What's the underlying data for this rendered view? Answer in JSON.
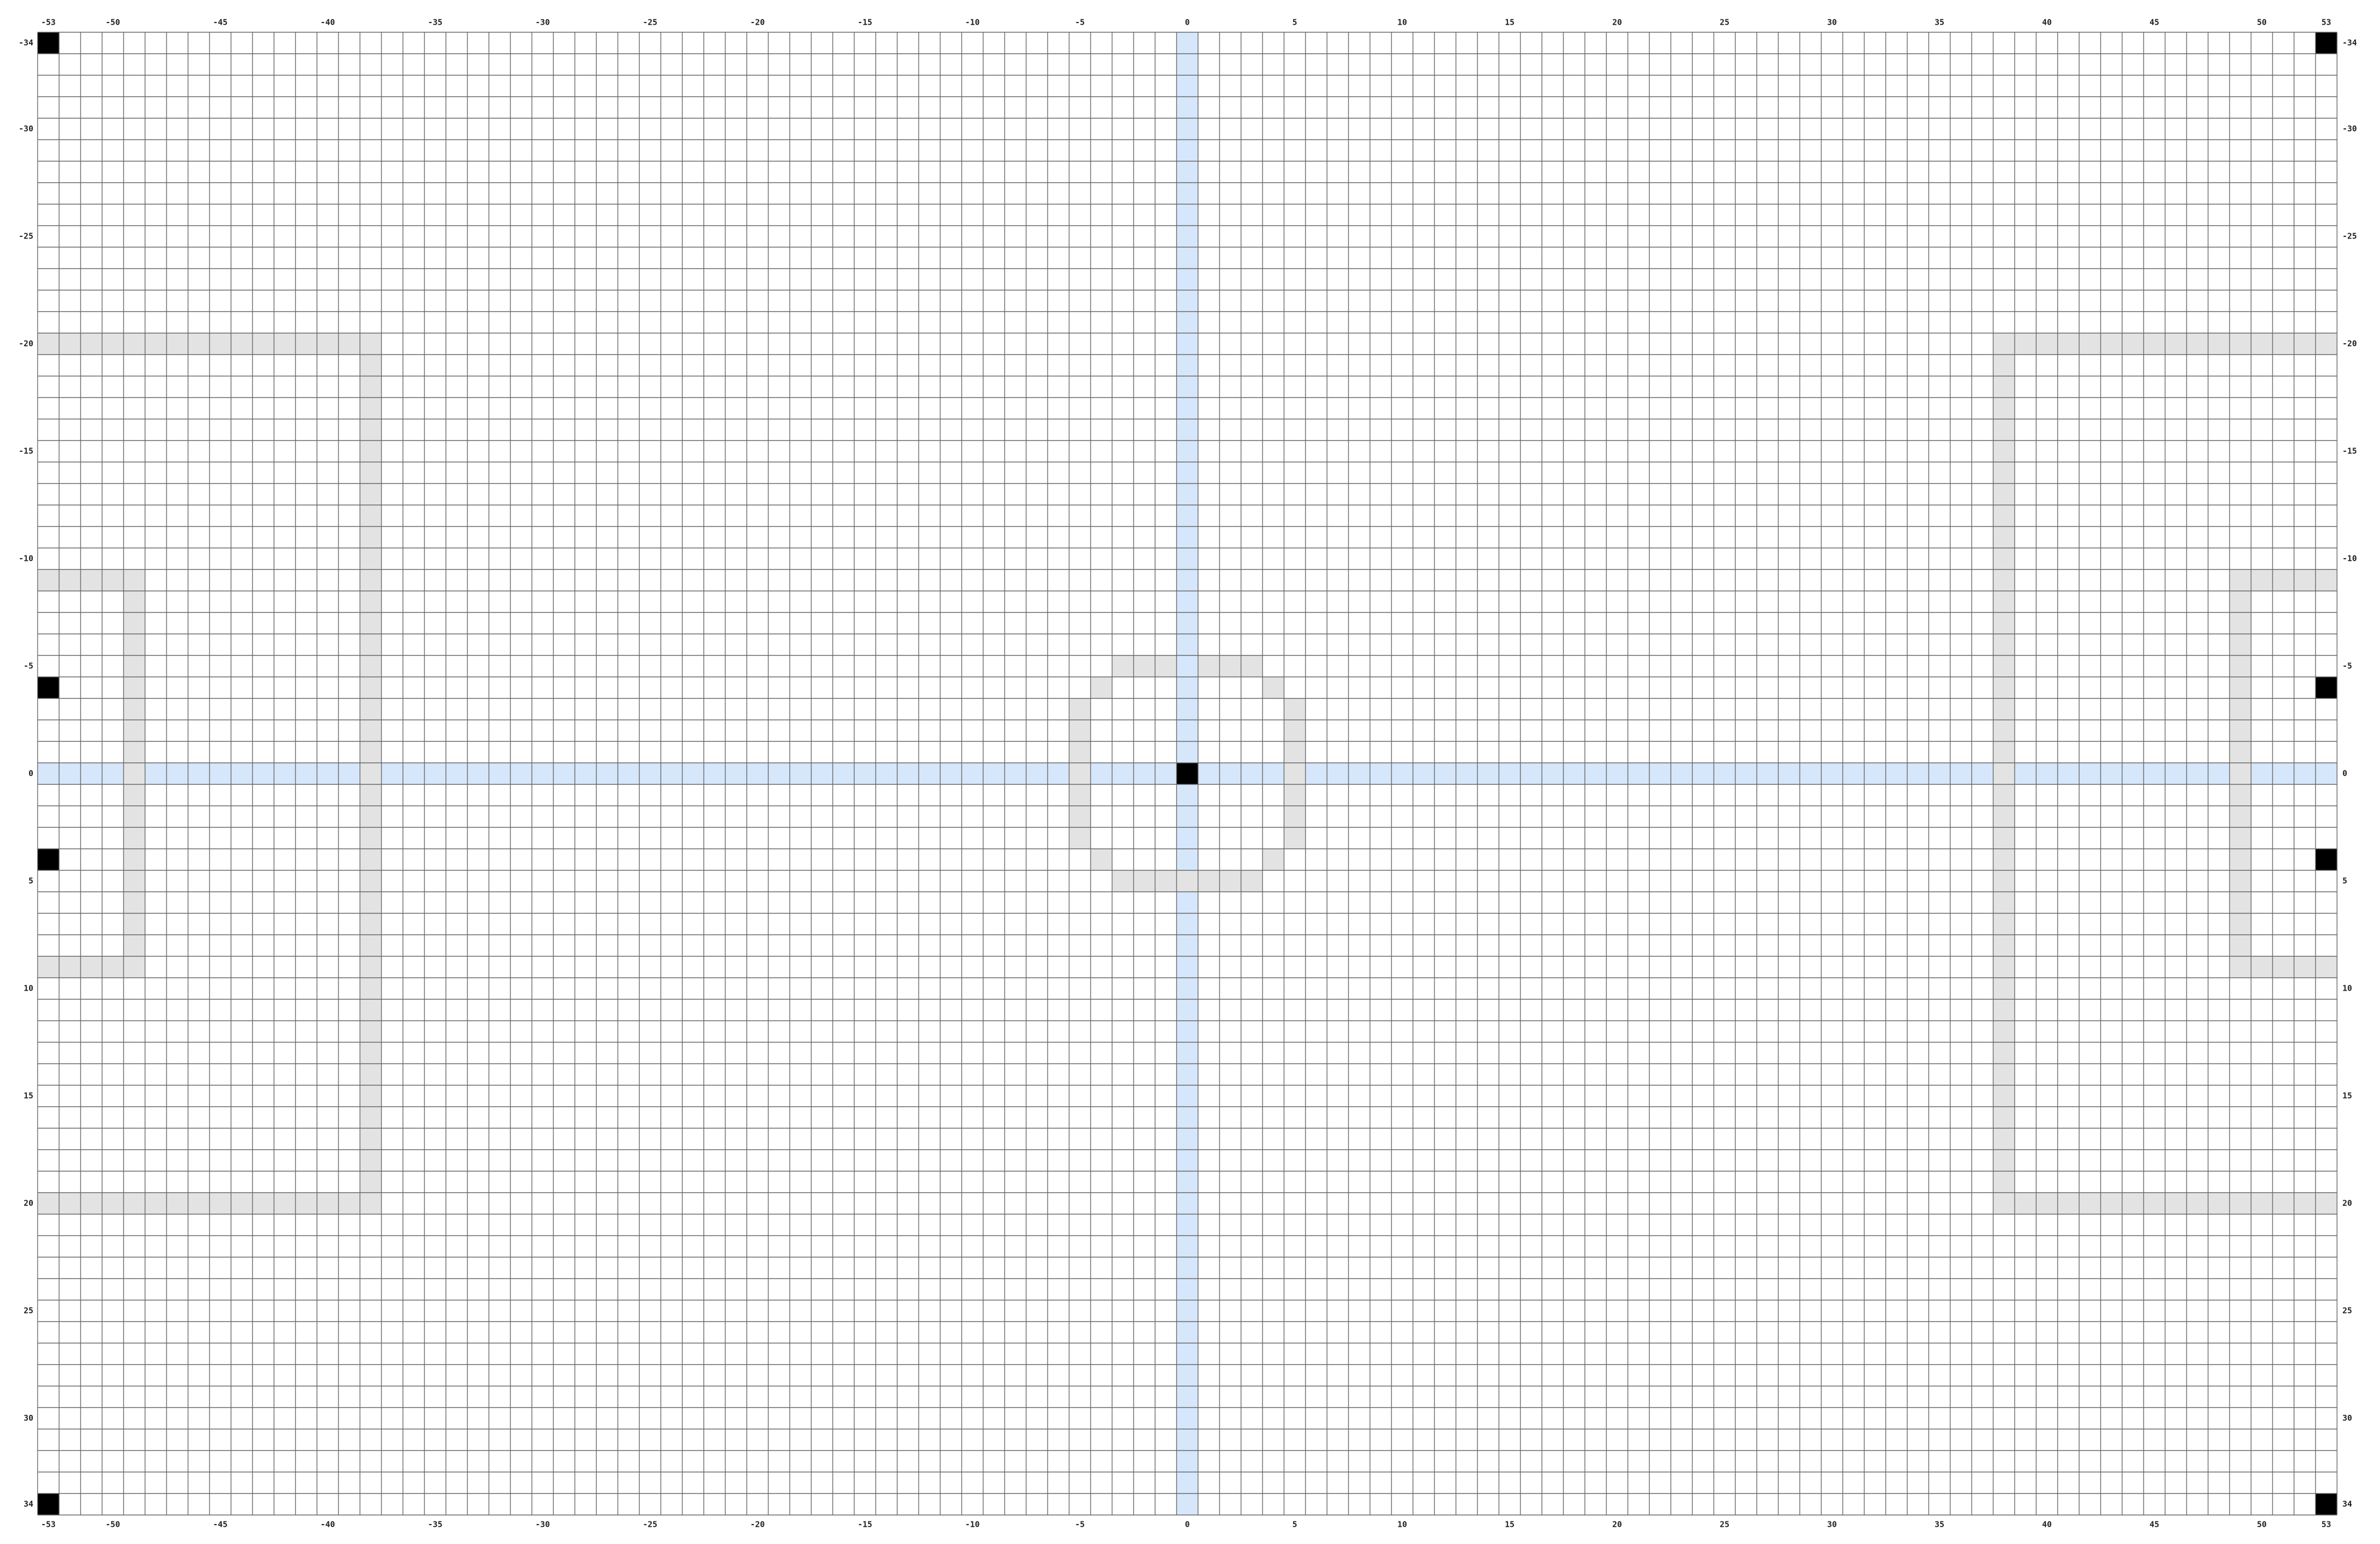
{
  "grid": {
    "x_min": -53,
    "x_max": 53,
    "y_min": -34,
    "y_max": 34,
    "axis_labels_x": [
      -53,
      -50,
      -45,
      -40,
      -35,
      -30,
      -25,
      -20,
      -15,
      -10,
      -5,
      0,
      5,
      10,
      15,
      20,
      25,
      30,
      35,
      40,
      45,
      50,
      53
    ],
    "axis_labels_y": [
      -34,
      -30,
      -25,
      -20,
      -15,
      -10,
      -5,
      0,
      5,
      10,
      15,
      20,
      25,
      30,
      34
    ],
    "colors": {
      "background": "#ffffff",
      "grid_line": "#666666",
      "axis_highlight": "#d6e6fb",
      "field_marking": "#e3e3e3",
      "marker": "#000000",
      "label": "#222222"
    }
  },
  "markers": [
    [
      -53,
      -34
    ],
    [
      53,
      -34
    ],
    [
      -53,
      34
    ],
    [
      53,
      34
    ],
    [
      -53,
      -4
    ],
    [
      -53,
      4
    ],
    [
      53,
      -4
    ],
    [
      53,
      4
    ],
    [
      0,
      0
    ]
  ],
  "field_markings": {
    "left_penalty_area": {
      "x_range": [
        -53,
        -38
      ],
      "y_range": [
        -20,
        20
      ]
    },
    "right_penalty_area": {
      "x_range": [
        38,
        53
      ],
      "y_range": [
        -20,
        20
      ]
    },
    "left_goal_area": {
      "x_range": [
        -53,
        -49
      ],
      "y_range": [
        -9,
        9
      ]
    },
    "right_goal_area": {
      "x_range": [
        49,
        53
      ],
      "y_range": [
        -9,
        9
      ]
    },
    "center_circle": {
      "cells": [
        [
          -3,
          -5
        ],
        [
          -2,
          -5
        ],
        [
          -1,
          -5
        ],
        [
          1,
          -5
        ],
        [
          2,
          -5
        ],
        [
          3,
          -5
        ],
        [
          -4,
          -4
        ],
        [
          4,
          -4
        ],
        [
          -5,
          -3
        ],
        [
          5,
          -3
        ],
        [
          -5,
          -2
        ],
        [
          5,
          -2
        ],
        [
          -5,
          -1
        ],
        [
          5,
          -1
        ],
        [
          -5,
          0
        ],
        [
          5,
          0
        ],
        [
          -5,
          1
        ],
        [
          5,
          1
        ],
        [
          -5,
          2
        ],
        [
          5,
          2
        ],
        [
          -5,
          3
        ],
        [
          5,
          3
        ],
        [
          -4,
          4
        ],
        [
          4,
          4
        ],
        [
          -3,
          5
        ],
        [
          -2,
          5
        ],
        [
          -1,
          5
        ],
        [
          0,
          5
        ],
        [
          1,
          5
        ],
        [
          2,
          5
        ],
        [
          3,
          5
        ]
      ]
    }
  }
}
